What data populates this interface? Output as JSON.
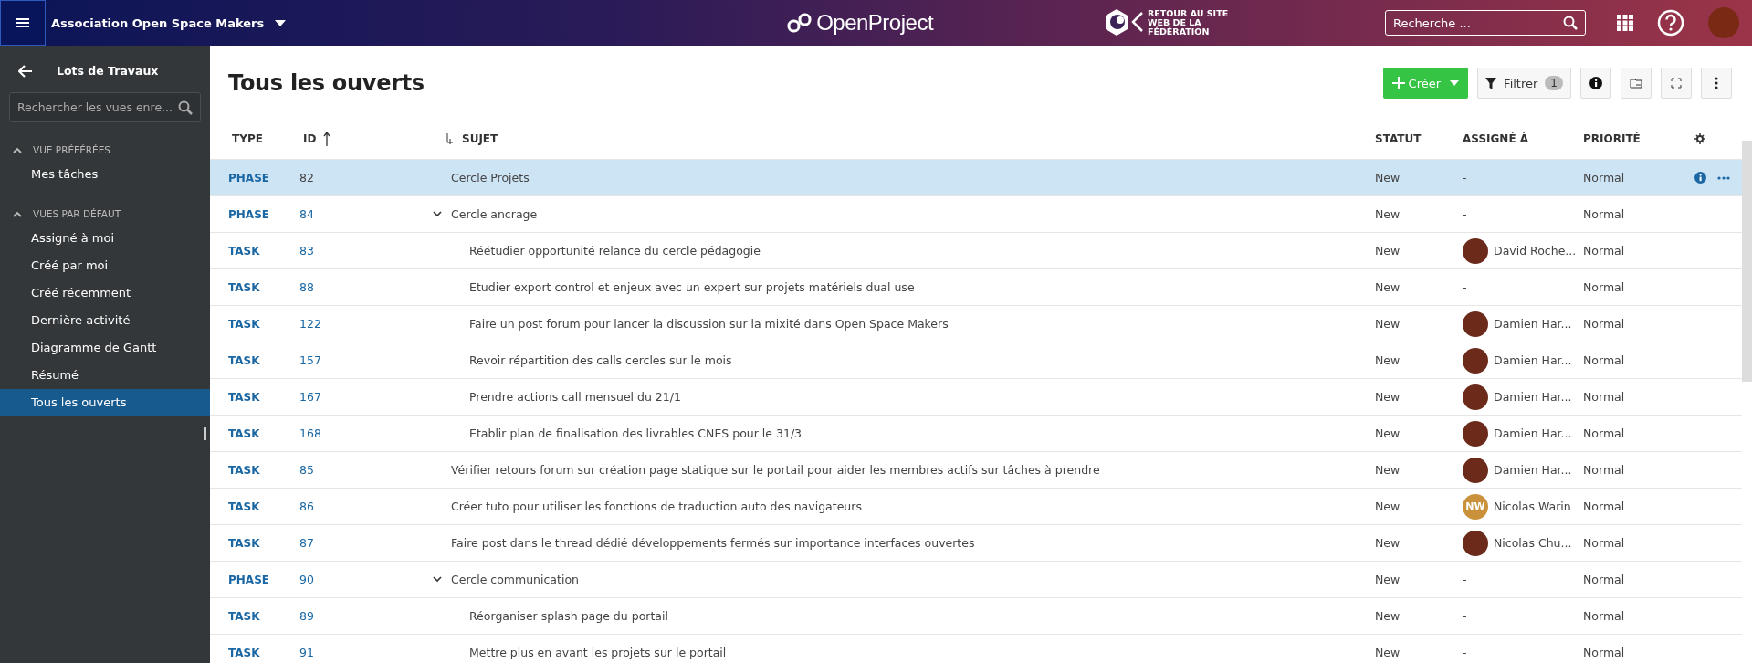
{
  "header": {
    "project": "Association Open Space Makers",
    "logo": "OpenProject",
    "back_link": "RETOUR AU SITE WEB DE LA FÉDÉRATION",
    "search": {
      "placeholder": "Recherche ..."
    }
  },
  "sidebar": {
    "title": "Lots de Travaux",
    "search": {
      "placeholder": "Rechercher les vues enre..."
    },
    "sections": [
      {
        "title": "VUE PRÉFÉRÉES",
        "expanded": true,
        "items": [
          {
            "label": "Mes tâches",
            "selected": false
          }
        ]
      },
      {
        "title": "VUES PAR DÉFAUT",
        "expanded": true,
        "items": [
          {
            "label": "Assigné à moi",
            "selected": false
          },
          {
            "label": "Créé par moi",
            "selected": false
          },
          {
            "label": "Créé récemment",
            "selected": false
          },
          {
            "label": "Dernière activité",
            "selected": false
          },
          {
            "label": "Diagramme de Gantt",
            "selected": false
          },
          {
            "label": "Résumé",
            "selected": false
          },
          {
            "label": "Tous les ouverts",
            "selected": true
          }
        ]
      }
    ]
  },
  "page": {
    "title": "Tous les ouverts",
    "create_button": "Créer",
    "filter_button": "Filtrer",
    "filter_count": "1"
  },
  "table": {
    "columns": [
      {
        "label": "TYPE",
        "sorted": false
      },
      {
        "label": "ID",
        "sorted": true
      },
      {
        "label": "SUJET",
        "sorted": false
      },
      {
        "label": "STATUT",
        "sorted": false
      },
      {
        "label": "ASSIGNÉ À",
        "sorted": false
      },
      {
        "label": "PRIORITÉ",
        "sorted": false
      }
    ],
    "rows": [
      {
        "type": "PHASE",
        "id": "82",
        "subject": "Cercle Projets",
        "status": "New",
        "assignee_empty": "-",
        "priority": "Normal",
        "selected": true
      },
      {
        "type": "PHASE",
        "id": "84",
        "subject": "Cercle ancrage",
        "status": "New",
        "assignee_empty": "-",
        "priority": "Normal",
        "selected": false,
        "expanded": true,
        "children": [
          {
            "type": "TASK",
            "id": "83",
            "subject": "Réétudier opportunité relance du cercle pédagogie",
            "status": "New",
            "assignee": {
              "name": "David Roche...",
              "kind": "photo"
            },
            "priority": "Normal",
            "selected": false
          },
          {
            "type": "TASK",
            "id": "88",
            "subject": "Etudier export control et enjeux avec un expert sur projets matériels dual use",
            "status": "New",
            "assignee_empty": "-",
            "priority": "Normal",
            "selected": false
          },
          {
            "type": "TASK",
            "id": "122",
            "subject": "Faire un post forum pour lancer la discussion sur la mixité dans Open Space Makers",
            "status": "New",
            "assignee": {
              "name": "Damien Har...",
              "kind": "photo"
            },
            "priority": "Normal",
            "selected": false
          },
          {
            "type": "TASK",
            "id": "157",
            "subject": "Revoir répartition des calls cercles sur le mois",
            "status": "New",
            "assignee": {
              "name": "Damien Har...",
              "kind": "photo"
            },
            "priority": "Normal",
            "selected": false
          },
          {
            "type": "TASK",
            "id": "167",
            "subject": "Prendre actions call mensuel du 21/1",
            "status": "New",
            "assignee": {
              "name": "Damien Har...",
              "kind": "photo"
            },
            "priority": "Normal",
            "selected": false
          },
          {
            "type": "TASK",
            "id": "168",
            "subject": "Etablir plan de finalisation des livrables CNES pour le 31/3",
            "status": "New",
            "assignee": {
              "name": "Damien Har...",
              "kind": "photo"
            },
            "priority": "Normal",
            "selected": false
          }
        ]
      },
      {
        "type": "TASK",
        "id": "85",
        "subject": "Vérifier retours forum sur création page statique sur le portail pour aider les membres actifs sur tâches à prendre",
        "status": "New",
        "assignee": {
          "name": "Damien Har...",
          "kind": "photo"
        },
        "priority": "Normal",
        "selected": false
      },
      {
        "type": "TASK",
        "id": "86",
        "subject": "Créer tuto pour utiliser les fonctions de traduction auto des navigateurs",
        "status": "New",
        "assignee": {
          "name": "Nicolas Warin",
          "kind": "initials",
          "initials": "NW",
          "color": "#c8913a"
        },
        "priority": "Normal",
        "selected": false
      },
      {
        "type": "TASK",
        "id": "87",
        "subject": "Faire post dans le thread dédié développements fermés sur importance interfaces ouvertes",
        "status": "New",
        "assignee": {
          "name": "Nicolas Chu...",
          "kind": "photo"
        },
        "priority": "Normal",
        "selected": false
      },
      {
        "type": "PHASE",
        "id": "90",
        "subject": "Cercle communication",
        "status": "New",
        "assignee_empty": "-",
        "priority": "Normal",
        "selected": false,
        "expanded": true,
        "children": [
          {
            "type": "TASK",
            "id": "89",
            "subject": "Réorganiser splash page du portail",
            "status": "New",
            "assignee_empty": "-",
            "priority": "Normal",
            "selected": false
          },
          {
            "type": "TASK",
            "id": "91",
            "subject": "Mettre plus en avant les projets sur le portail",
            "status": "New",
            "assignee_empty": "-",
            "priority": "Normal",
            "selected": false
          }
        ]
      }
    ]
  }
}
